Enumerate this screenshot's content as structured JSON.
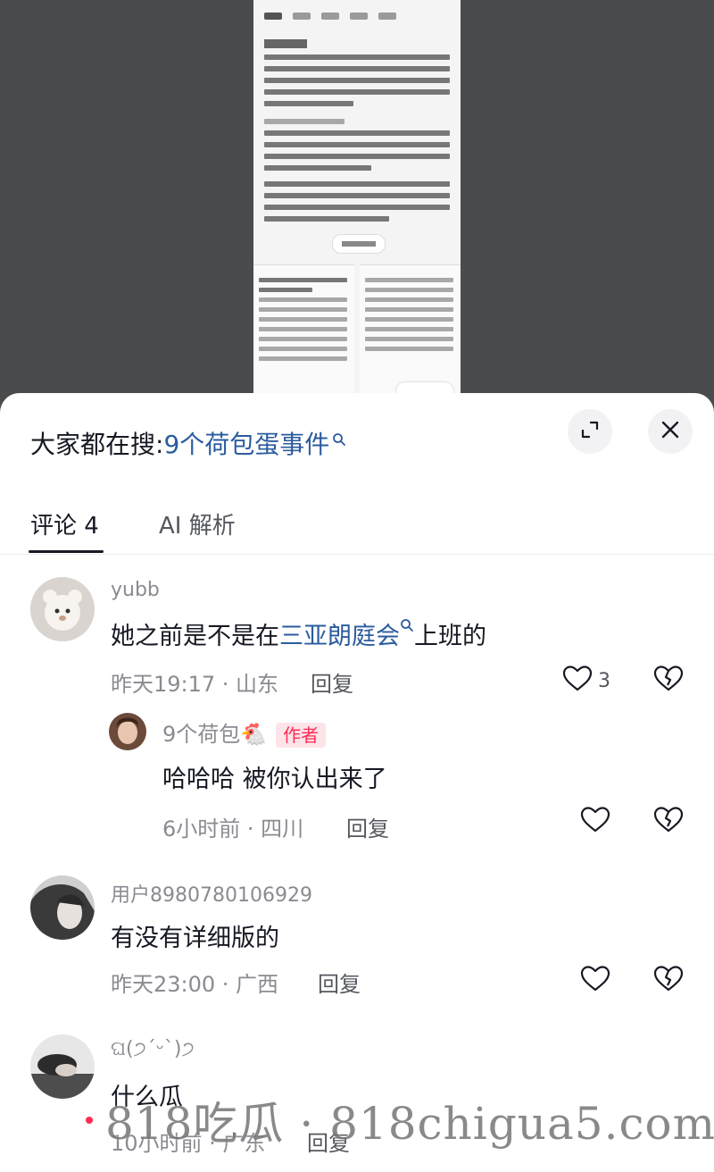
{
  "header": {
    "search_prefix": "大家都在搜:",
    "search_term": "9个荷包蛋事件"
  },
  "tabs": [
    {
      "label": "评论 4"
    },
    {
      "label": "AI 解析"
    }
  ],
  "comments": [
    {
      "username": "yubb",
      "text_before": "她之前是不是在",
      "mention": "三亚朗庭会",
      "text_after": "上班的",
      "meta": "昨天19:17 · 山东",
      "reply_label": "回复",
      "likes": "3",
      "replies": [
        {
          "username": "9个荷包🐔",
          "badge": "作者",
          "text": "哈哈哈 被你认出来了",
          "meta": "6小时前 · 四川",
          "reply_label": "回复"
        }
      ]
    },
    {
      "username": "用户8980780106929",
      "text": "有没有详细版的",
      "meta": "昨天23:00 · 广西",
      "reply_label": "回复"
    },
    {
      "username": "ଘ(੭ˊᵕˋ)੭",
      "text": "什么瓜",
      "meta": "10小时前 · 广东",
      "reply_label": "回复"
    }
  ],
  "watermark": "818吃瓜 · 818chigua5.com",
  "colors": {
    "accent_link": "#2b5c9e",
    "author_badge": "#fe2c55",
    "text_primary": "#161823",
    "text_secondary": "#8a8b91"
  },
  "icons": [
    "search-icon",
    "expand-icon",
    "close-icon",
    "heart-icon",
    "broken-heart-icon"
  ]
}
